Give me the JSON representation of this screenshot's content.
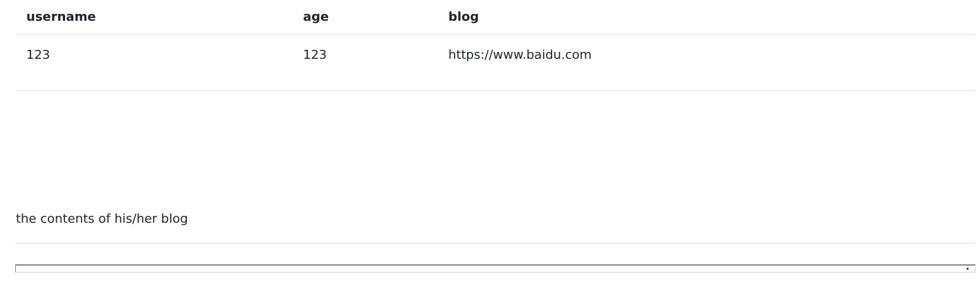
{
  "table": {
    "headers": {
      "username": "username",
      "age": "age",
      "blog": "blog"
    },
    "rows": [
      {
        "username": "123",
        "age": "123",
        "blog": "https://www.baidu.com"
      }
    ]
  },
  "blog_section": {
    "label": "the contents of his/her blog"
  }
}
